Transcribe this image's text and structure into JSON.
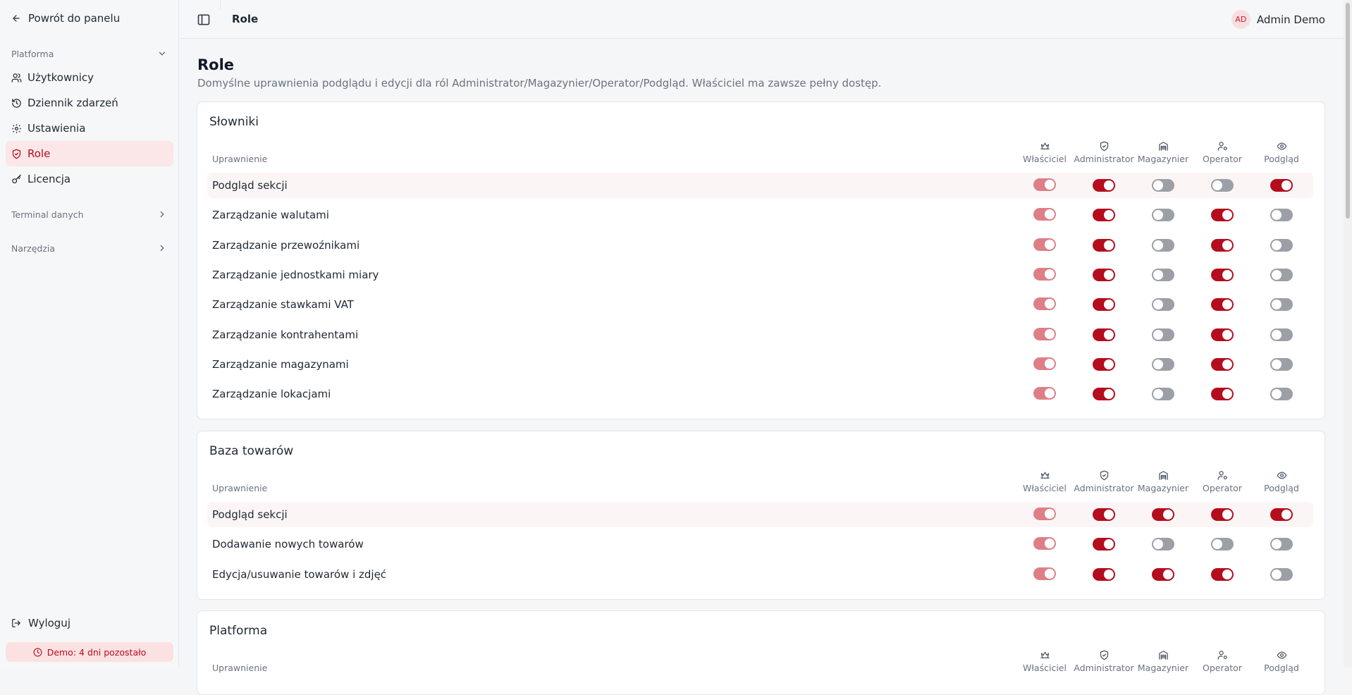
{
  "sidebar": {
    "back_label": "Powrót do panelu",
    "platform_group": "Platforma",
    "items": [
      {
        "label": "Użytkownicy",
        "icon": "users-icon"
      },
      {
        "label": "Dziennik zdarzeń",
        "icon": "history-icon"
      },
      {
        "label": "Ustawienia",
        "icon": "gear-icon"
      },
      {
        "label": "Role",
        "icon": "shield-icon",
        "active": true
      },
      {
        "label": "Licencja",
        "icon": "key-icon"
      }
    ],
    "terminal_group": "Terminal danych",
    "tools_group": "Narzędzia",
    "logout_label": "Wyloguj",
    "demo_label": "Demo: 4 dni pozostało"
  },
  "topbar": {
    "title": "Role",
    "user_initials": "AD",
    "user_name": "Admin Demo"
  },
  "page": {
    "title": "Role",
    "description": "Domyślne uprawnienia podglądu i edycji dla ról Administrator/Magazynier/Operator/Podgląd. Właściciel ma zawsze pełny dostęp."
  },
  "column_label": "Uprawnienie",
  "roles": [
    {
      "label": "Właściciel",
      "icon": "crown-icon"
    },
    {
      "label": "Administrator",
      "icon": "shield-check-icon"
    },
    {
      "label": "Magazynier",
      "icon": "warehouse-icon"
    },
    {
      "label": "Operator",
      "icon": "user-cog-icon"
    },
    {
      "label": "Podgląd",
      "icon": "eye-icon"
    }
  ],
  "sections": [
    {
      "title": "Słowniki",
      "rows": [
        {
          "label": "Podgląd sekcji",
          "states": [
            true,
            true,
            false,
            false,
            true
          ]
        },
        {
          "label": "Zarządzanie walutami",
          "states": [
            true,
            true,
            false,
            true,
            false
          ]
        },
        {
          "label": "Zarządzanie przewoźnikami",
          "states": [
            true,
            true,
            false,
            true,
            false
          ]
        },
        {
          "label": "Zarządzanie jednostkami miary",
          "states": [
            true,
            true,
            false,
            true,
            false
          ]
        },
        {
          "label": "Zarządzanie stawkami VAT",
          "states": [
            true,
            true,
            false,
            true,
            false
          ]
        },
        {
          "label": "Zarządzanie kontrahentami",
          "states": [
            true,
            true,
            false,
            true,
            false
          ]
        },
        {
          "label": "Zarządzanie magazynami",
          "states": [
            true,
            true,
            false,
            true,
            false
          ]
        },
        {
          "label": "Zarządzanie lokacjami",
          "states": [
            true,
            true,
            false,
            true,
            false
          ]
        }
      ]
    },
    {
      "title": "Baza towarów",
      "rows": [
        {
          "label": "Podgląd sekcji",
          "states": [
            true,
            true,
            true,
            true,
            true
          ]
        },
        {
          "label": "Dodawanie nowych towarów",
          "states": [
            true,
            true,
            false,
            false,
            false
          ]
        },
        {
          "label": "Edycja/usuwanie towarów i zdjęć",
          "states": [
            true,
            true,
            true,
            true,
            false
          ]
        }
      ]
    },
    {
      "title": "Platforma",
      "rows": []
    }
  ],
  "colors": {
    "accent": "#b40d1e",
    "owner_toggle": "#de7f88",
    "off_toggle": "#9ca0a6",
    "active_nav_bg": "#fbe7e8"
  }
}
